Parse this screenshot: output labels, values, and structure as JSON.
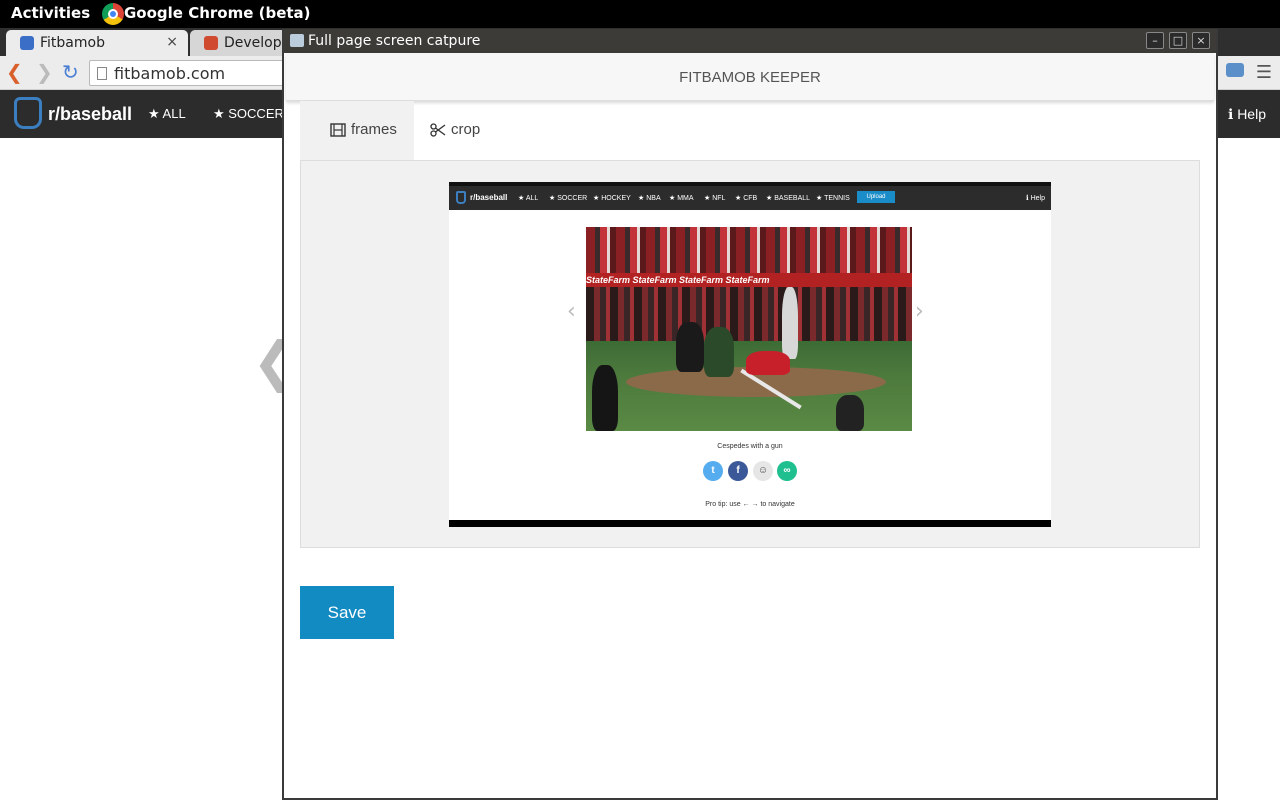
{
  "desktop": {
    "activities": "Activities",
    "app_name": "Google Chrome (beta)"
  },
  "browser": {
    "tabs": [
      {
        "label": "Fitbamob",
        "close": "×"
      },
      {
        "label": "Developer"
      }
    ],
    "url": "fitbamob.com"
  },
  "site": {
    "brand": "r/baseball",
    "nav": [
      "★ ALL",
      "★ SOCCER"
    ],
    "help": "ℹ Help"
  },
  "popup": {
    "window_title": "Full page screen catpure",
    "header": "FITBAMOB KEEPER",
    "tabs": [
      {
        "label": "frames",
        "icon": "film-icon"
      },
      {
        "label": "crop",
        "icon": "scissors-icon"
      }
    ],
    "save_label": "Save"
  },
  "preview": {
    "brand": "r/baseball",
    "nav": [
      "★ ALL",
      "★ SOCCER",
      "★ HOCKEY",
      "★ NBA",
      "★ MMA",
      "★ NFL",
      "★ CFB",
      "★ BASEBALL",
      "★ TENNIS"
    ],
    "upload": "Upload",
    "help": "ℹ Help",
    "ad_text": "StateFarm   StateFarm   StateFarm   StateFarm",
    "caption": "Cespedes with a gun",
    "share_icons": [
      "twitter-icon",
      "facebook-icon",
      "reddit-icon",
      "link-icon"
    ],
    "pro_tip": "Pro tip: use ← → to navigate"
  },
  "colors": {
    "accent": "#128ac2",
    "dark_bar": "#2c2c2c"
  }
}
